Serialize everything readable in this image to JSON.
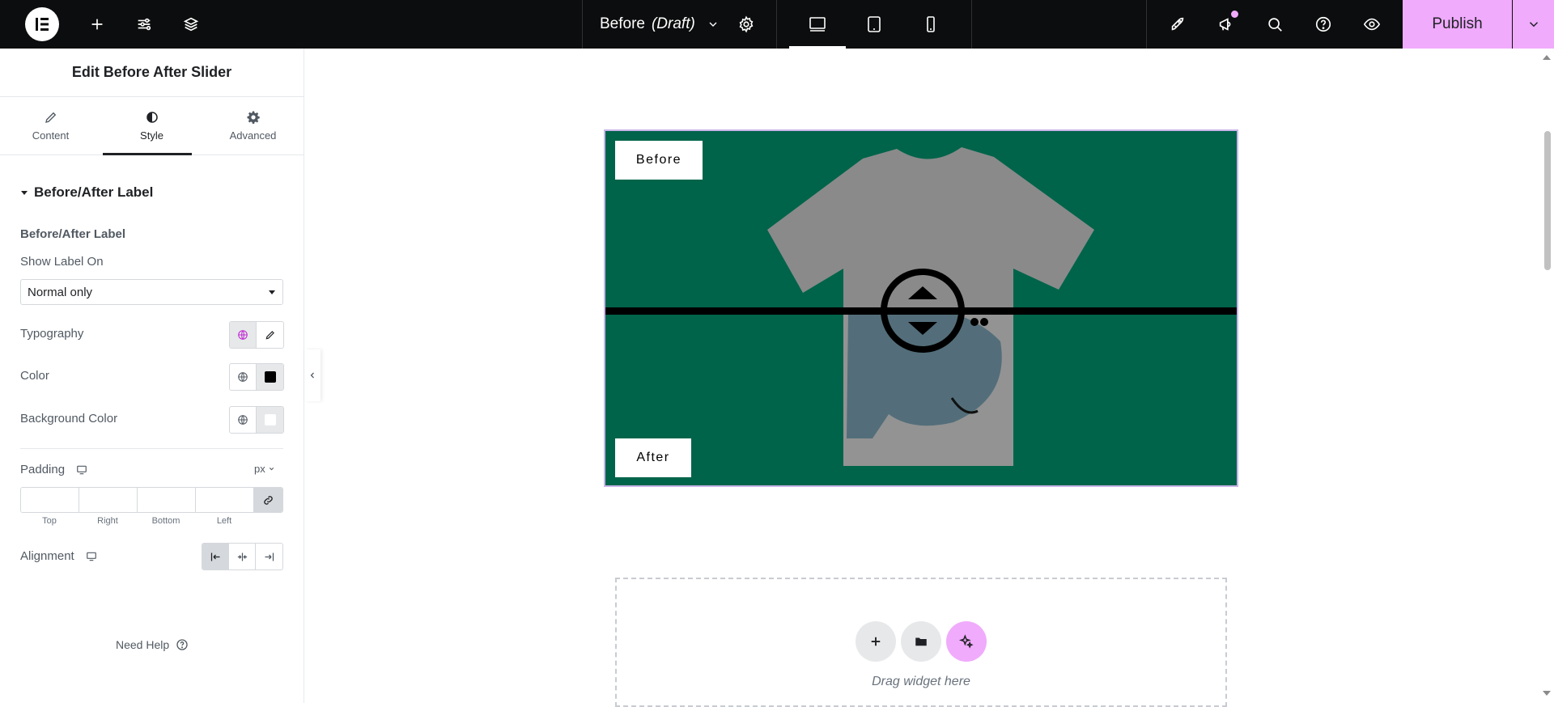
{
  "topbar": {
    "doc_title": "Before",
    "doc_status": "(Draft)",
    "publish_label": "Publish"
  },
  "panel": {
    "title": "Edit Before After Slider",
    "tabs": [
      {
        "label": "Content",
        "icon": "pencil-icon"
      },
      {
        "label": "Style",
        "icon": "half-circle-icon"
      },
      {
        "label": "Advanced",
        "icon": "gear-icon"
      }
    ],
    "section_title": "Before/After Label",
    "sub_heading": "Before/After Label",
    "show_label_on": {
      "label": "Show Label On",
      "value": "Normal only"
    },
    "typography_label": "Typography",
    "color_label": "Color",
    "color_value": "#000000",
    "background_color_label": "Background Color",
    "background_color_value": "#ffffff",
    "padding": {
      "label": "Padding",
      "unit": "px",
      "sides": [
        "Top",
        "Right",
        "Bottom",
        "Left"
      ]
    },
    "alignment_label": "Alignment",
    "need_help": "Need Help"
  },
  "canvas": {
    "before_label": "Before",
    "after_label": "After",
    "drop_text": "Drag widget here",
    "slider_bg": "#00644a"
  }
}
